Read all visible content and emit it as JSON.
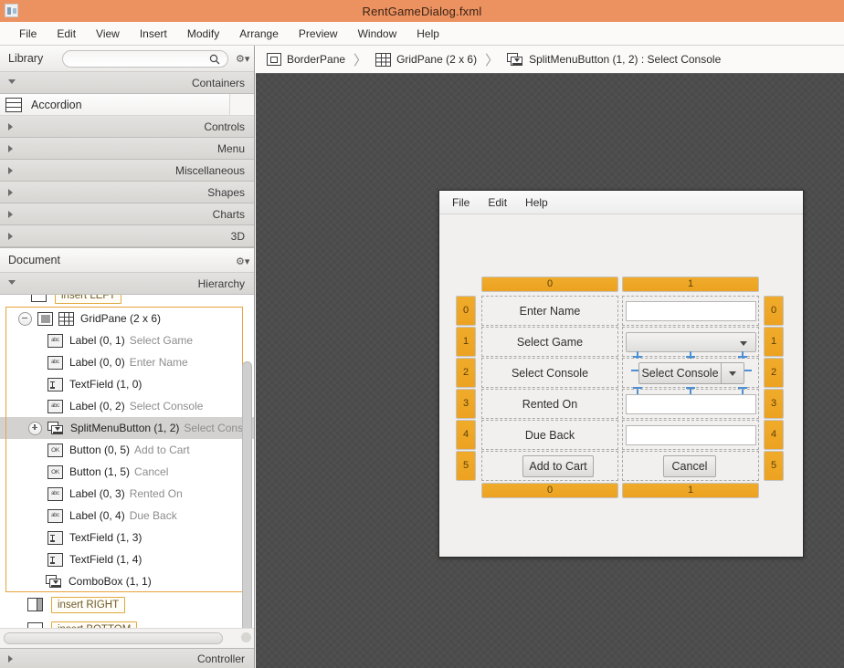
{
  "window": {
    "title": "RentGameDialog.fxml",
    "icon": "app-icon"
  },
  "menubar": {
    "items": [
      "File",
      "Edit",
      "View",
      "Insert",
      "Modify",
      "Arrange",
      "Preview",
      "Window",
      "Help"
    ]
  },
  "library": {
    "header_label": "Library",
    "search_placeholder": "",
    "search_value": "",
    "search_icon": "search-icon",
    "gear_icon": "gear-icon",
    "sections": [
      {
        "label": "Containers",
        "expanded": true
      },
      {
        "label": "Controls",
        "expanded": false
      },
      {
        "label": "Menu",
        "expanded": false
      },
      {
        "label": "Miscellaneous",
        "expanded": false
      },
      {
        "label": "Shapes",
        "expanded": false
      },
      {
        "label": "Charts",
        "expanded": false
      },
      {
        "label": "3D",
        "expanded": false
      }
    ],
    "items": [
      {
        "label": "Accordion",
        "icon": "accordion-icon"
      }
    ]
  },
  "document": {
    "header_label": "Document",
    "gear_icon": "gear-icon",
    "hierarchy_label": "Hierarchy",
    "controller_label": "Controller",
    "tree": [
      {
        "icon": "border-icon",
        "text": "insert LEFT",
        "sub": "",
        "kind": "insert",
        "indent": 1
      },
      {
        "icon": "grid-icon",
        "text": "GridPane (2 x 6)",
        "sub": "",
        "kind": "node",
        "indent": 0,
        "expander": "minus",
        "extra_icon": "pane-icon"
      },
      {
        "icon": "label-icon",
        "text": "Label (0, 1)",
        "sub": "Select Game",
        "kind": "node",
        "indent": 2
      },
      {
        "icon": "label-icon",
        "text": "Label (0, 0)",
        "sub": "Enter Name",
        "kind": "node",
        "indent": 2
      },
      {
        "icon": "textfield-icon",
        "text": "TextField (1, 0)",
        "sub": "",
        "kind": "node",
        "indent": 2
      },
      {
        "icon": "label-icon",
        "text": "Label (0, 2)",
        "sub": "Select Console",
        "kind": "node",
        "indent": 2
      },
      {
        "icon": "splitmenubutton-icon",
        "text": "SplitMenuButton (1, 2)",
        "sub": "Select Conso",
        "kind": "node",
        "indent": 1,
        "expander": "plus",
        "selected": true
      },
      {
        "icon": "button-icon",
        "text": "Button (0, 5)",
        "sub": "Add to Cart",
        "kind": "node",
        "indent": 2
      },
      {
        "icon": "button-icon",
        "text": "Button (1, 5)",
        "sub": "Cancel",
        "kind": "node",
        "indent": 2
      },
      {
        "icon": "label-icon",
        "text": "Label (0, 3)",
        "sub": "Rented On",
        "kind": "node",
        "indent": 2
      },
      {
        "icon": "label-icon",
        "text": "Label (0, 4)",
        "sub": "Due Back",
        "kind": "node",
        "indent": 2
      },
      {
        "icon": "textfield-icon",
        "text": "TextField (1, 3)",
        "sub": "",
        "kind": "node",
        "indent": 2
      },
      {
        "icon": "textfield-icon",
        "text": "TextField (1, 4)",
        "sub": "",
        "kind": "node",
        "indent": 2
      },
      {
        "icon": "combobox-icon",
        "text": "ComboBox (1, 1)",
        "sub": "",
        "kind": "node",
        "indent": 2
      },
      {
        "icon": "insert-right-icon",
        "text": "insert RIGHT",
        "sub": "",
        "kind": "insert",
        "indent": 1
      },
      {
        "icon": "insert-bottom-icon",
        "text": "insert BOTTOM",
        "sub": "",
        "kind": "insert",
        "indent": 1
      }
    ]
  },
  "breadcrumb": {
    "items": [
      {
        "icon": "borderpane-icon",
        "label": "BorderPane"
      },
      {
        "icon": "gridpane-icon",
        "label": "GridPane (2 x 6)"
      },
      {
        "icon": "splitmenubutton-icon",
        "label": "SplitMenuButton (1, 2) : Select Console"
      }
    ],
    "separator": "〉"
  },
  "preview": {
    "menubar": [
      "File",
      "Edit",
      "Help"
    ],
    "column_headers_top": [
      "0",
      "1"
    ],
    "column_headers_bottom": [
      "0",
      "1"
    ],
    "row_headers_left": [
      "0",
      "1",
      "2",
      "3",
      "4",
      "5"
    ],
    "row_headers_right": [
      "0",
      "1",
      "2",
      "3",
      "4",
      "5"
    ],
    "rows": [
      {
        "label": "Enter Name",
        "control": "textfield",
        "value": ""
      },
      {
        "label": "Select Game",
        "control": "combobox",
        "value": ""
      },
      {
        "label": "Select Console",
        "control": "splitmenubutton",
        "value": "Select Console",
        "selected": true
      },
      {
        "label": "Rented On",
        "control": "textfield",
        "value": ""
      },
      {
        "label": "Due Back",
        "control": "textfield",
        "value": ""
      }
    ],
    "buttons": {
      "primary": "Add to Cart",
      "secondary": "Cancel"
    }
  },
  "colors": {
    "titlebar": "#ec9260",
    "accent_orange": "#eda221",
    "selection_blue": "#4b8fd6",
    "canvas_bg": "#4a4a4a",
    "panel_bg": "#f3f2f1"
  }
}
